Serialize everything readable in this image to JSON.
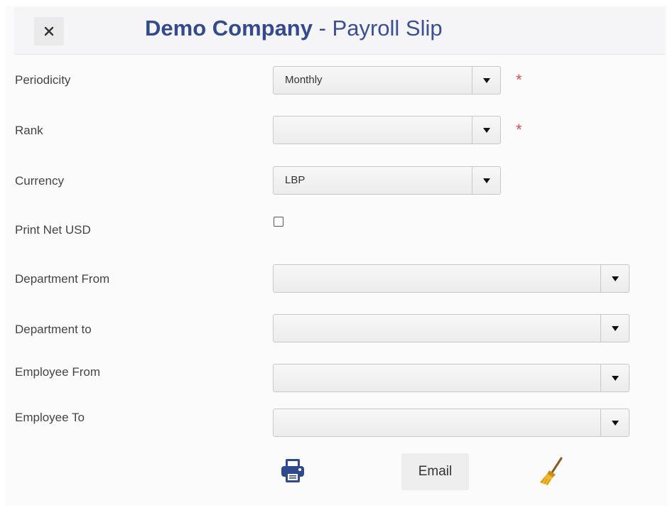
{
  "header": {
    "company": "Demo Company",
    "separator": " - ",
    "report_title": "Payroll Slip",
    "close_icon": "close-icon"
  },
  "form": {
    "periodicity": {
      "label": "Periodicity",
      "value": "Monthly",
      "required": true
    },
    "rank": {
      "label": "Rank",
      "value": "",
      "required": true
    },
    "currency": {
      "label": "Currency",
      "value": "LBP",
      "required": false
    },
    "print_net_usd": {
      "label": "Print Net USD",
      "checked": false
    },
    "department_from": {
      "label": "Department From",
      "value": ""
    },
    "department_to": {
      "label": "Department to",
      "value": ""
    },
    "employee_from": {
      "label": "Employee From",
      "value": ""
    },
    "employee_to": {
      "label": "Employee To",
      "value": ""
    },
    "required_marker": "*"
  },
  "actions": {
    "print_icon": "print-icon",
    "email_label": "Email",
    "clear_icon": "broom-icon"
  },
  "colors": {
    "title": "#344a8f",
    "required": "#d9534f",
    "print_icon": "#2e4a8c",
    "broom_icon": "#e0a21a"
  }
}
